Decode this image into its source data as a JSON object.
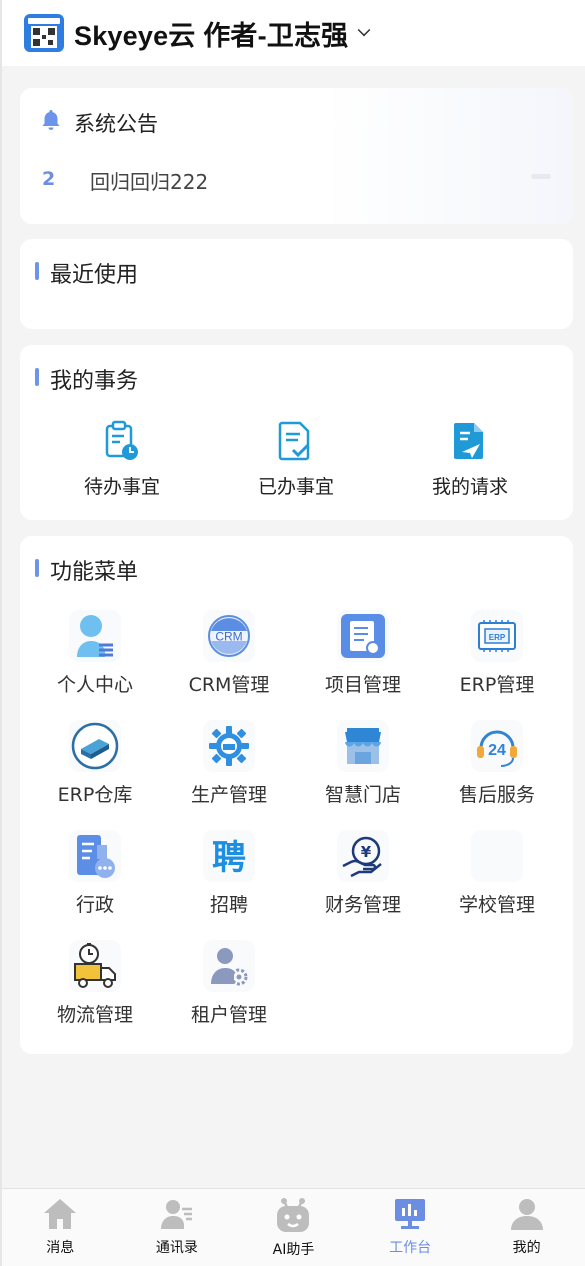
{
  "header": {
    "title": "Skyeye云 作者-卫志强"
  },
  "notice": {
    "title": "系统公告",
    "index": "2",
    "text": "回归回归222"
  },
  "recent": {
    "title": "最近使用"
  },
  "tasks": {
    "title": "我的事务",
    "items": [
      {
        "label": "待办事宜",
        "icon": "clipboard-clock-icon"
      },
      {
        "label": "已办事宜",
        "icon": "document-check-icon"
      },
      {
        "label": "我的请求",
        "icon": "document-send-icon"
      }
    ]
  },
  "menu": {
    "title": "功能菜单",
    "items": [
      {
        "label": "个人中心",
        "icon": "person-icon"
      },
      {
        "label": "CRM管理",
        "icon": "crm-icon",
        "badge": "CRM"
      },
      {
        "label": "项目管理",
        "icon": "project-icon"
      },
      {
        "label": "ERP管理",
        "icon": "erp-chip-icon",
        "badge": "ERP"
      },
      {
        "label": "ERP仓库",
        "icon": "warehouse-icon"
      },
      {
        "label": "生产管理",
        "icon": "production-gear-icon"
      },
      {
        "label": "智慧门店",
        "icon": "store-icon"
      },
      {
        "label": "售后服务",
        "icon": "support-24-icon",
        "badge": "24"
      },
      {
        "label": "行政",
        "icon": "admin-doc-icon"
      },
      {
        "label": "招聘",
        "icon": "recruit-icon",
        "badge": "聘"
      },
      {
        "label": "财务管理",
        "icon": "finance-yen-icon",
        "badge": "¥"
      },
      {
        "label": "学校管理",
        "icon": "school-icon"
      },
      {
        "label": "物流管理",
        "icon": "logistics-truck-icon"
      },
      {
        "label": "租户管理",
        "icon": "tenant-icon"
      }
    ]
  },
  "tabbar": {
    "items": [
      {
        "label": "消息",
        "icon": "home-icon"
      },
      {
        "label": "通讯录",
        "icon": "contacts-icon"
      },
      {
        "label": "AI助手",
        "icon": "robot-icon"
      },
      {
        "label": "工作台",
        "icon": "workbench-icon",
        "active": true
      },
      {
        "label": "我的",
        "icon": "user-icon"
      }
    ]
  },
  "colors": {
    "accent": "#6b94ea",
    "active_tab": "#6b8ee3",
    "background": "#f4f4f4"
  }
}
